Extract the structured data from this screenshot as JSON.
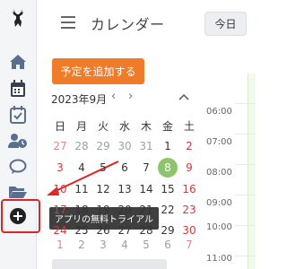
{
  "header": {
    "title": "カレンダー",
    "today_button": "今日"
  },
  "main": {
    "add_event_button": "予定を追加する",
    "month_label": "2023年9月",
    "weekdays": [
      "日",
      "月",
      "火",
      "水",
      "木",
      "金",
      "土"
    ],
    "weeks": [
      [
        "27",
        "28",
        "29",
        "30",
        "31",
        "1",
        "2"
      ],
      [
        "3",
        "4",
        "5",
        "6",
        "7",
        "8",
        "9"
      ],
      [
        "10",
        "11",
        "12",
        "13",
        "14",
        "15",
        "16"
      ],
      [
        "17",
        "18",
        "19",
        "20",
        "21",
        "22",
        "23"
      ],
      [
        "24",
        "25",
        "26",
        "27",
        "28",
        "29",
        "30"
      ],
      [
        "1",
        "2",
        "3",
        "4",
        "5",
        "6",
        "7"
      ]
    ],
    "today": "8"
  },
  "tooltip": {
    "text": "アプリの無料トライアル"
  },
  "timeline": {
    "times": [
      "06:00",
      "07:00",
      "08:00",
      "09:00",
      "10:00",
      "11:00"
    ]
  },
  "colors": {
    "accent_orange": "#f07c2a",
    "today_green": "#8cc56b",
    "highlight_red": "#e02424",
    "icon_blue": "#5a6f8e"
  }
}
